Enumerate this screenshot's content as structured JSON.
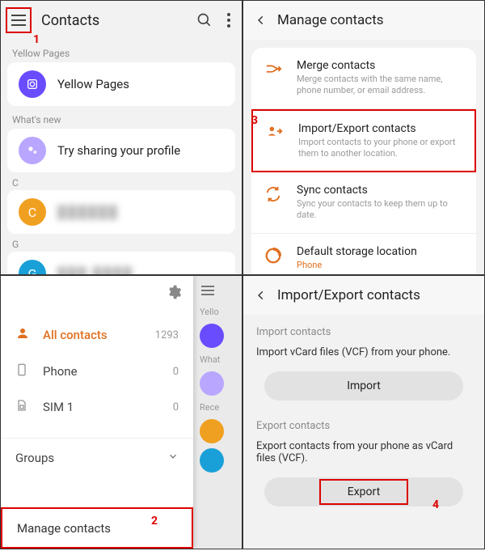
{
  "panel1": {
    "title": "Contacts",
    "sections": {
      "yellow_pages_label": "Yellow Pages",
      "yellow_pages_item": "Yellow Pages",
      "whats_new_label": "What's new",
      "whats_new_item": "Try sharing your profile",
      "index_c": "C",
      "contact_c": "██████",
      "index_g": "G",
      "contact_g": "███ ████"
    },
    "annotation": "1"
  },
  "panel2": {
    "title": "Manage contacts",
    "items": [
      {
        "title": "Merge contacts",
        "sub": "Merge contacts with the same name, phone number, or email address."
      },
      {
        "title": "Import/Export contacts",
        "sub": "Import contacts to your phone or export them to another location."
      },
      {
        "title": "Sync contacts",
        "sub": "Sync your contacts to keep them up to date."
      },
      {
        "title": "Default storage location",
        "sub": "Phone"
      }
    ],
    "annotation": "3"
  },
  "panel3": {
    "items": [
      {
        "label": "All contacts",
        "count": "1293"
      },
      {
        "label": "Phone",
        "count": "0"
      },
      {
        "label": "SIM 1",
        "count": "0"
      }
    ],
    "groups_label": "Groups",
    "manage_label": "Manage contacts",
    "behind_labels": [
      "Yello",
      "What",
      "Rece"
    ],
    "annotation": "2"
  },
  "panel4": {
    "title": "Import/Export contacts",
    "import_label": "Import contacts",
    "import_desc": "Import vCard files (VCF) from your phone.",
    "import_btn": "Import",
    "export_label": "Export contacts",
    "export_desc": "Export contacts from your phone as vCard files (VCF).",
    "export_btn": "Export",
    "annotation": "4"
  }
}
